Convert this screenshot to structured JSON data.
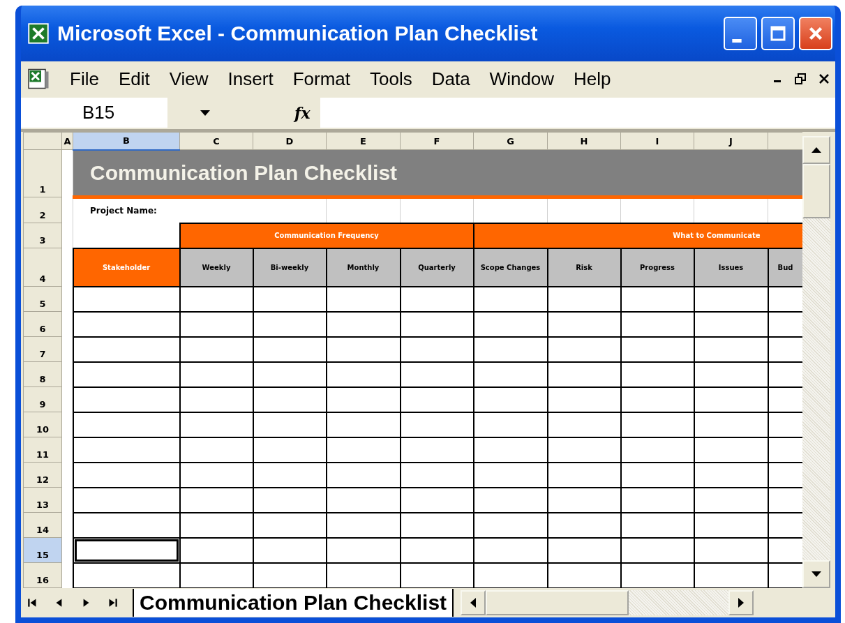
{
  "window": {
    "title": "Microsoft Excel - Communication Plan Checklist"
  },
  "menu": [
    "File",
    "Edit",
    "View",
    "Insert",
    "Format",
    "Tools",
    "Data",
    "Window",
    "Help"
  ],
  "formula_bar": {
    "name_box": "B15",
    "function_label": "fx"
  },
  "columns": [
    {
      "label": "A",
      "selected": false
    },
    {
      "label": "B",
      "selected": true
    },
    {
      "label": "C",
      "selected": false
    },
    {
      "label": "D",
      "selected": false
    },
    {
      "label": "E",
      "selected": false
    },
    {
      "label": "F",
      "selected": false
    },
    {
      "label": "G",
      "selected": false
    },
    {
      "label": "H",
      "selected": false
    },
    {
      "label": "I",
      "selected": false
    },
    {
      "label": "J",
      "selected": false
    }
  ],
  "sheet": {
    "title": "Communication Plan Checklist",
    "project_label": "Project Name:",
    "first_header": "Stakeholder",
    "groups": [
      {
        "label": "Communication Frequency",
        "headers": [
          "Weekly",
          "Bi-weekly",
          "Monthly",
          "Quarterly"
        ]
      },
      {
        "label": "What to Communicate",
        "headers": [
          "Scope Changes",
          "Risk",
          "Progress",
          "Issues",
          "Bud"
        ]
      }
    ]
  },
  "rows": [
    {
      "label": "1",
      "kind": "title",
      "selected": false
    },
    {
      "label": "2",
      "kind": "project",
      "selected": false
    },
    {
      "label": "3",
      "kind": "group",
      "selected": false
    },
    {
      "label": "4",
      "kind": "header",
      "selected": false
    },
    {
      "label": "5",
      "kind": "data",
      "selected": false
    },
    {
      "label": "6",
      "kind": "data",
      "selected": false
    },
    {
      "label": "7",
      "kind": "data",
      "selected": false
    },
    {
      "label": "8",
      "kind": "data",
      "selected": false
    },
    {
      "label": "9",
      "kind": "data",
      "selected": false
    },
    {
      "label": "10",
      "kind": "data",
      "selected": false
    },
    {
      "label": "11",
      "kind": "data",
      "selected": false
    },
    {
      "label": "12",
      "kind": "data",
      "selected": false
    },
    {
      "label": "13",
      "kind": "data",
      "selected": false
    },
    {
      "label": "14",
      "kind": "data",
      "selected": false
    },
    {
      "label": "15",
      "kind": "data",
      "selected": true
    },
    {
      "label": "16",
      "kind": "data",
      "selected": false
    }
  ],
  "sheet_tabs": [
    {
      "label": "Communication Plan Checklist",
      "selected": true
    }
  ]
}
